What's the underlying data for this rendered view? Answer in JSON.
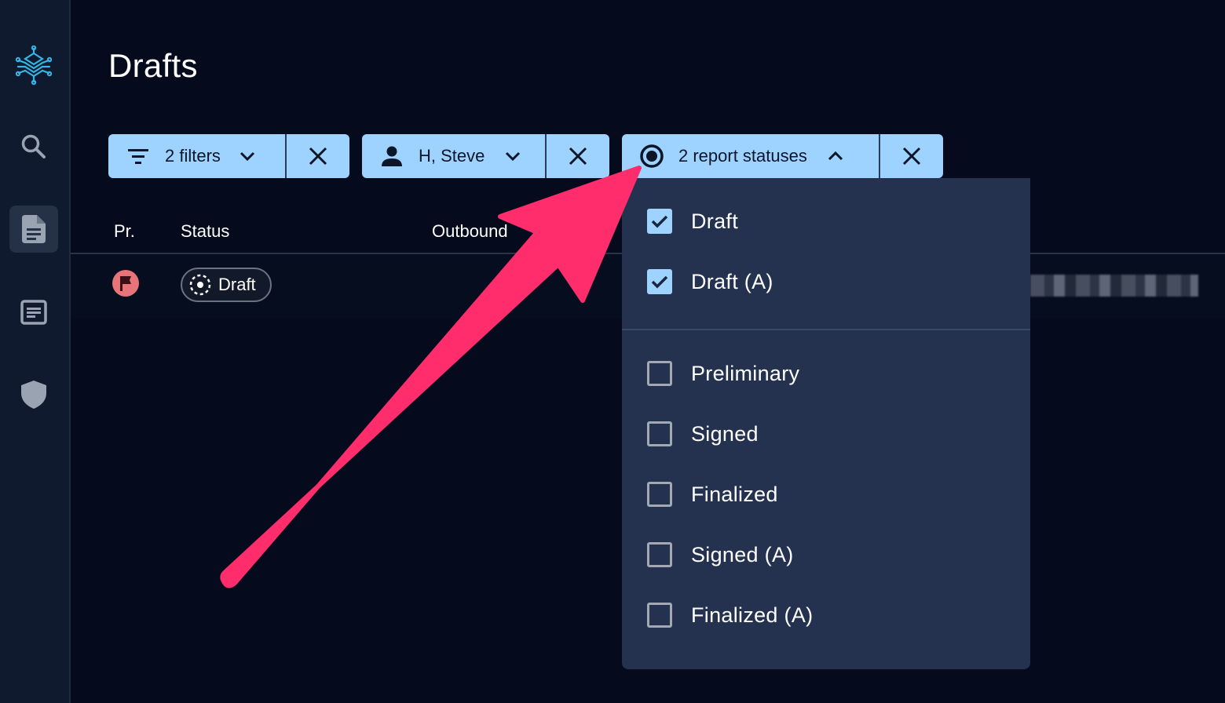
{
  "page": {
    "title": "Drafts"
  },
  "filters": {
    "filter_chip": {
      "label": "2 filters",
      "icon": "filter-icon"
    },
    "user_chip": {
      "label": "H, Steve",
      "icon": "person-icon"
    },
    "status_chip": {
      "label": "2 report statuses",
      "icon": "radio-icon"
    }
  },
  "table": {
    "columns": [
      "Pr.",
      "Status",
      "Outbound"
    ],
    "rows": [
      {
        "priority_icon": "flag-icon",
        "status": "Draft"
      }
    ]
  },
  "status_dropdown": {
    "options": [
      {
        "label": "Draft",
        "checked": true
      },
      {
        "label": "Draft (A)",
        "checked": true
      },
      {
        "label": "Preliminary",
        "checked": false
      },
      {
        "label": "Signed",
        "checked": false
      },
      {
        "label": "Finalized",
        "checked": false
      },
      {
        "label": "Signed (A)",
        "checked": false
      },
      {
        "label": "Finalized (A)",
        "checked": false
      }
    ]
  },
  "colors": {
    "background": "#050b1c",
    "sidebar": "#101a2e",
    "chip": "#9ed3ff",
    "dropdown": "#243250",
    "annotation_arrow": "#ff2d6b",
    "priority_flag": "#e8747a"
  }
}
